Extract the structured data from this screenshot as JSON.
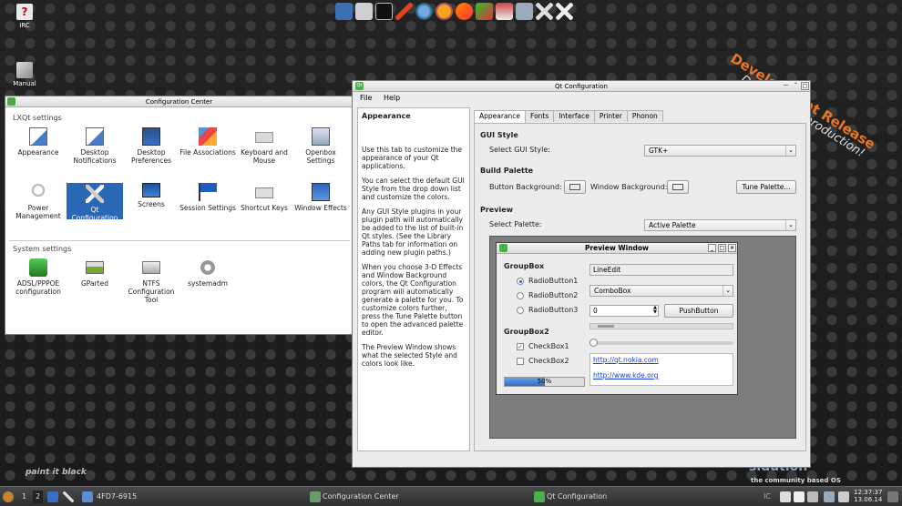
{
  "desktop": {
    "icons": [
      {
        "label": "IRC",
        "icon": "irc-icon"
      },
      {
        "label": "Manual",
        "icon": "manual-icon"
      }
    ],
    "watermark": {
      "title": "Development Release",
      "subtitle": "Don't use in production!"
    },
    "slogan": "paint it black",
    "brand": "sidution",
    "brand_sub": "the community based OS",
    "launcher_icons": [
      "calculator-icon",
      "disk-icon",
      "terminal-icon",
      "pen-icon",
      "globe-icon",
      "block-icon",
      "feather-icon",
      "bird-icon",
      "tools-icon",
      "camera-icon",
      "wrench-icon",
      "cross-tools-icon"
    ]
  },
  "config_center": {
    "title": "Configuration Center",
    "lxqt_section": "LXQt settings",
    "lxqt_items": [
      {
        "label": "Appearance",
        "icon": "appearance-icon"
      },
      {
        "label": "Desktop Notifications",
        "icon": "notifications-icon"
      },
      {
        "label": "Desktop Preferences",
        "icon": "desktop-icon"
      },
      {
        "label": "File Associations",
        "icon": "file-associations-icon"
      },
      {
        "label": "Keyboard and Mouse",
        "icon": "keyboard-icon"
      },
      {
        "label": "Openbox Settings",
        "icon": "openbox-icon"
      },
      {
        "label": "Power Management",
        "icon": "power-icon"
      },
      {
        "label": "Qt Configuration",
        "icon": "qt-config-icon",
        "selected": true
      },
      {
        "label": "Screens",
        "icon": "screens-icon"
      },
      {
        "label": "Session Settings",
        "icon": "session-icon"
      },
      {
        "label": "Shortcut Keys",
        "icon": "shortcut-icon"
      },
      {
        "label": "Window Effects",
        "icon": "window-effects-icon"
      }
    ],
    "system_section": "System settings",
    "system_items": [
      {
        "label": "ADSL/PPPOE configuration",
        "icon": "network-icon"
      },
      {
        "label": "GParted",
        "icon": "gparted-icon"
      },
      {
        "label": "NTFS Configuration Tool",
        "icon": "ntfs-icon"
      },
      {
        "label": "systemadm",
        "icon": "gear-icon"
      }
    ]
  },
  "qt_config": {
    "title": "Qt Configuration",
    "menu": [
      "File",
      "Help"
    ],
    "left_title": "Appearance",
    "help_paragraphs": [
      "Use this tab to customize the appearance of your Qt applications.",
      "You can select the default GUI Style from the drop down list and customize the colors.",
      "Any GUI Style plugins in your plugin path will automatically be added to the list of built-in Qt styles. (See the Library Paths tab for information on adding new plugin paths.)",
      "When you choose 3-D Effects and Window Background colors, the Qt Configuration program will automatically generate a palette for you. To customize colors further, press the Tune Palette button to open the advanced palette editor.",
      "The Preview Window shows what the selected Style and colors look like."
    ],
    "tabs": [
      "Appearance",
      "Fonts",
      "Interface",
      "Printer",
      "Phonon"
    ],
    "gui_style": {
      "heading": "GUI Style",
      "label": "Select GUI Style:",
      "value": "GTK+"
    },
    "build_palette": {
      "heading": "Build Palette",
      "button_bg": "Button Background:",
      "window_bg": "Window Background:",
      "tune": "Tune Palette..."
    },
    "preview": {
      "heading": "Preview",
      "label": "Select Palette:",
      "value": "Active Palette"
    },
    "preview_window": {
      "title": "Preview Window",
      "groupbox": "GroupBox",
      "radios": [
        "RadioButton1",
        "RadioButton2",
        "RadioButton3"
      ],
      "lineedit": "LineEdit",
      "combobox": "ComboBox",
      "spin_value": "0",
      "pushbutton": "PushButton",
      "groupbox2": "GroupBox2",
      "checks": [
        "CheckBox1",
        "CheckBox2"
      ],
      "links": [
        "http://qt.nokia.com",
        "http://www.kde.org"
      ],
      "progress_text": "50%",
      "progress": 0.5,
      "slider": 0.0
    }
  },
  "taskbar": {
    "desktops": [
      "1",
      "2"
    ],
    "mount": "4FD7-6915",
    "tasks": [
      {
        "label": "Configuration Center",
        "icon": "config-center-icon"
      },
      {
        "label": "Qt Configuration",
        "icon": "qt-icon"
      }
    ],
    "time": "12:37:37",
    "date": "13.06.14",
    "tray_text": "IC"
  }
}
